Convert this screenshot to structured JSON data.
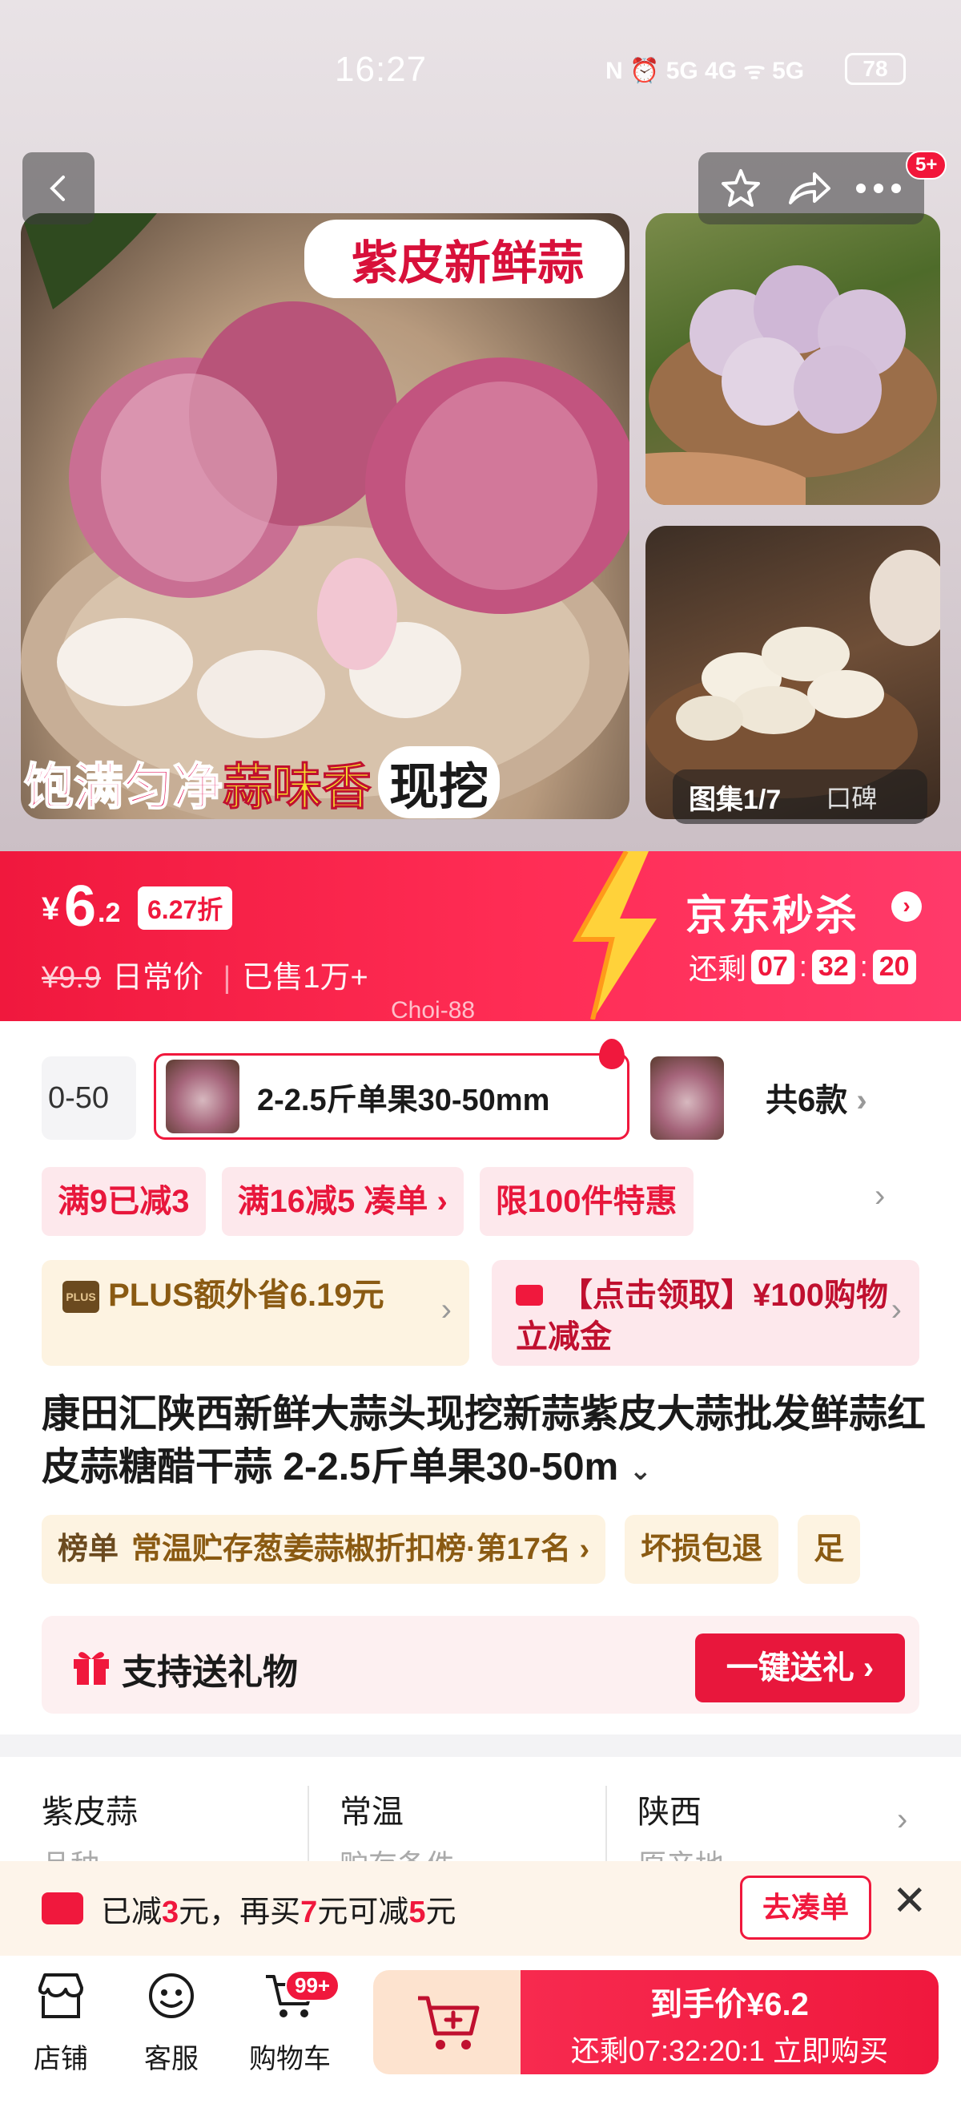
{
  "status": {
    "time": "16:27",
    "icons": "N ⏰ 5G 4G ᯤ 5G",
    "battery": "78"
  },
  "topbar": {
    "badge": "5+"
  },
  "gallery": {
    "main_banner_top": "紫皮新鲜蒜",
    "main_banner_bottom_a": "饱满匀净",
    "main_banner_bottom_b": "蒜味香",
    "main_banner_bottom_c": "现挖",
    "counter": "图集1/7",
    "reviews": "口碑"
  },
  "price": {
    "currency": "¥",
    "int": "6",
    "dec": ".2",
    "discount": "6.27折",
    "orig": "¥9.9",
    "orig_label": "日常价",
    "sold": "已售1万+",
    "flash_title": "京东秒杀",
    "remain_label": "还剩",
    "hh": "07",
    "mm": "32",
    "ss": "20",
    "watermark": "Choi-88"
  },
  "variants": {
    "left_partial": "0-50",
    "selected": "2-2.5斤单果30-50mm",
    "count": "共6款"
  },
  "promos": [
    "满9已减3",
    "满16减5  凑单 ›",
    "限100件特惠"
  ],
  "plus": {
    "text": "PLUS额外省6.19元",
    "logo": "PLUS"
  },
  "coupon": {
    "text": "【点击领取】¥100购物立减金"
  },
  "product": {
    "title": "康田汇陕西新鲜大蒜头现挖新蒜紫皮大蒜批发鲜蒜红皮蒜糖醋干蒜 2-2.5斤单果30-50m"
  },
  "rank": {
    "label": "榜单",
    "text": "常温贮存葱姜蒜椒折扣榜·第17名 ›",
    "tag2": "坏损包退",
    "tag3": "足"
  },
  "gift": {
    "text": "支持送礼物",
    "button": "一键送礼 ›"
  },
  "attrs": [
    {
      "value": "紫皮蒜",
      "label": "品种"
    },
    {
      "value": "常温",
      "label": "贮存条件"
    },
    {
      "value": "陕西",
      "label": "原产地"
    }
  ],
  "notice": {
    "a": "已减",
    "b": "3",
    "c": "元，再买",
    "d": "7",
    "e": "元可减",
    "f": "5",
    "g": "元",
    "button": "去凑单"
  },
  "tabs": {
    "shop": "店铺",
    "service": "客服",
    "cart": "购物车",
    "cart_badge": "99+"
  },
  "buy": {
    "line1_label": "到手价",
    "line1_price": "¥6.2",
    "line2": "还剩07:32:20:1  立即购买"
  },
  "colors": {
    "accent": "#f0183d",
    "plus": "#8a5a12",
    "bg": "#f3f3f5"
  }
}
